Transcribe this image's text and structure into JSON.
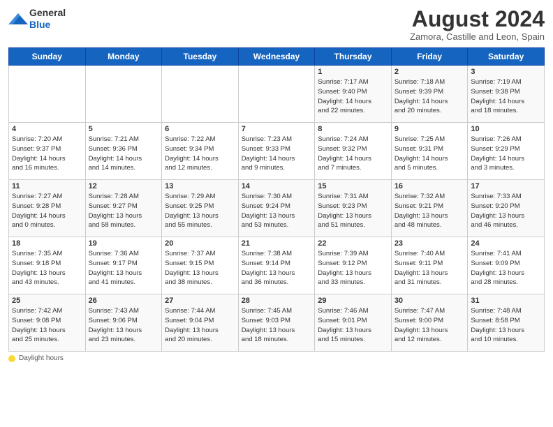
{
  "header": {
    "logo_line1": "General",
    "logo_line2": "Blue",
    "month_title": "August 2024",
    "location": "Zamora, Castille and Leon, Spain"
  },
  "days_of_week": [
    "Sunday",
    "Monday",
    "Tuesday",
    "Wednesday",
    "Thursday",
    "Friday",
    "Saturday"
  ],
  "weeks": [
    [
      {
        "num": "",
        "info": ""
      },
      {
        "num": "",
        "info": ""
      },
      {
        "num": "",
        "info": ""
      },
      {
        "num": "",
        "info": ""
      },
      {
        "num": "1",
        "info": "Sunrise: 7:17 AM\nSunset: 9:40 PM\nDaylight: 14 hours\nand 22 minutes."
      },
      {
        "num": "2",
        "info": "Sunrise: 7:18 AM\nSunset: 9:39 PM\nDaylight: 14 hours\nand 20 minutes."
      },
      {
        "num": "3",
        "info": "Sunrise: 7:19 AM\nSunset: 9:38 PM\nDaylight: 14 hours\nand 18 minutes."
      }
    ],
    [
      {
        "num": "4",
        "info": "Sunrise: 7:20 AM\nSunset: 9:37 PM\nDaylight: 14 hours\nand 16 minutes."
      },
      {
        "num": "5",
        "info": "Sunrise: 7:21 AM\nSunset: 9:36 PM\nDaylight: 14 hours\nand 14 minutes."
      },
      {
        "num": "6",
        "info": "Sunrise: 7:22 AM\nSunset: 9:34 PM\nDaylight: 14 hours\nand 12 minutes."
      },
      {
        "num": "7",
        "info": "Sunrise: 7:23 AM\nSunset: 9:33 PM\nDaylight: 14 hours\nand 9 minutes."
      },
      {
        "num": "8",
        "info": "Sunrise: 7:24 AM\nSunset: 9:32 PM\nDaylight: 14 hours\nand 7 minutes."
      },
      {
        "num": "9",
        "info": "Sunrise: 7:25 AM\nSunset: 9:31 PM\nDaylight: 14 hours\nand 5 minutes."
      },
      {
        "num": "10",
        "info": "Sunrise: 7:26 AM\nSunset: 9:29 PM\nDaylight: 14 hours\nand 3 minutes."
      }
    ],
    [
      {
        "num": "11",
        "info": "Sunrise: 7:27 AM\nSunset: 9:28 PM\nDaylight: 14 hours\nand 0 minutes."
      },
      {
        "num": "12",
        "info": "Sunrise: 7:28 AM\nSunset: 9:27 PM\nDaylight: 13 hours\nand 58 minutes."
      },
      {
        "num": "13",
        "info": "Sunrise: 7:29 AM\nSunset: 9:25 PM\nDaylight: 13 hours\nand 55 minutes."
      },
      {
        "num": "14",
        "info": "Sunrise: 7:30 AM\nSunset: 9:24 PM\nDaylight: 13 hours\nand 53 minutes."
      },
      {
        "num": "15",
        "info": "Sunrise: 7:31 AM\nSunset: 9:23 PM\nDaylight: 13 hours\nand 51 minutes."
      },
      {
        "num": "16",
        "info": "Sunrise: 7:32 AM\nSunset: 9:21 PM\nDaylight: 13 hours\nand 48 minutes."
      },
      {
        "num": "17",
        "info": "Sunrise: 7:33 AM\nSunset: 9:20 PM\nDaylight: 13 hours\nand 46 minutes."
      }
    ],
    [
      {
        "num": "18",
        "info": "Sunrise: 7:35 AM\nSunset: 9:18 PM\nDaylight: 13 hours\nand 43 minutes."
      },
      {
        "num": "19",
        "info": "Sunrise: 7:36 AM\nSunset: 9:17 PM\nDaylight: 13 hours\nand 41 minutes."
      },
      {
        "num": "20",
        "info": "Sunrise: 7:37 AM\nSunset: 9:15 PM\nDaylight: 13 hours\nand 38 minutes."
      },
      {
        "num": "21",
        "info": "Sunrise: 7:38 AM\nSunset: 9:14 PM\nDaylight: 13 hours\nand 36 minutes."
      },
      {
        "num": "22",
        "info": "Sunrise: 7:39 AM\nSunset: 9:12 PM\nDaylight: 13 hours\nand 33 minutes."
      },
      {
        "num": "23",
        "info": "Sunrise: 7:40 AM\nSunset: 9:11 PM\nDaylight: 13 hours\nand 31 minutes."
      },
      {
        "num": "24",
        "info": "Sunrise: 7:41 AM\nSunset: 9:09 PM\nDaylight: 13 hours\nand 28 minutes."
      }
    ],
    [
      {
        "num": "25",
        "info": "Sunrise: 7:42 AM\nSunset: 9:08 PM\nDaylight: 13 hours\nand 25 minutes."
      },
      {
        "num": "26",
        "info": "Sunrise: 7:43 AM\nSunset: 9:06 PM\nDaylight: 13 hours\nand 23 minutes."
      },
      {
        "num": "27",
        "info": "Sunrise: 7:44 AM\nSunset: 9:04 PM\nDaylight: 13 hours\nand 20 minutes."
      },
      {
        "num": "28",
        "info": "Sunrise: 7:45 AM\nSunset: 9:03 PM\nDaylight: 13 hours\nand 18 minutes."
      },
      {
        "num": "29",
        "info": "Sunrise: 7:46 AM\nSunset: 9:01 PM\nDaylight: 13 hours\nand 15 minutes."
      },
      {
        "num": "30",
        "info": "Sunrise: 7:47 AM\nSunset: 9:00 PM\nDaylight: 13 hours\nand 12 minutes."
      },
      {
        "num": "31",
        "info": "Sunrise: 7:48 AM\nSunset: 8:58 PM\nDaylight: 13 hours\nand 10 minutes."
      }
    ]
  ],
  "footer": {
    "daylight_label": "Daylight hours"
  }
}
